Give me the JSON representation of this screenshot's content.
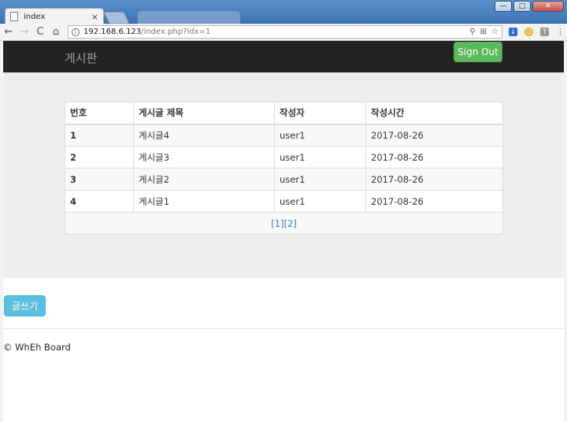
{
  "browser": {
    "tab_title": "index",
    "tab_close": "×",
    "url_host": "192.168.6.123",
    "url_path": "/index.php?idx=1",
    "nav_back": "←",
    "nav_forward": "→",
    "nav_reload": "C",
    "nav_home": "⌂",
    "info": "i",
    "zoom_icon": "⚲",
    "translate_icon": "⊞",
    "star_icon": "☆",
    "ext1": "↓",
    "ext2": "☺",
    "ext3": "T",
    "menu": "⋮",
    "win_min": "—",
    "win_max": "□",
    "win_close": "✕"
  },
  "navbar": {
    "brand": "게시판",
    "signout_label": "Sign Out",
    "signout_color": "#5cb85c"
  },
  "table": {
    "headers": [
      "번호",
      "게시글 제목",
      "작성자",
      "작성시간"
    ],
    "rows": [
      {
        "num": "1",
        "title": "게시글4",
        "author": "user1",
        "date": "2017-08-26"
      },
      {
        "num": "2",
        "title": "게시글3",
        "author": "user1",
        "date": "2017-08-26"
      },
      {
        "num": "3",
        "title": "게시글2",
        "author": "user1",
        "date": "2017-08-26"
      },
      {
        "num": "4",
        "title": "게시글1",
        "author": "user1",
        "date": "2017-08-26"
      }
    ],
    "pages": [
      "[1]",
      "[2]"
    ]
  },
  "write_button": {
    "label": "글쓰기",
    "color": "#5bc0de"
  },
  "footer": {
    "text": "© WhEh Board"
  }
}
